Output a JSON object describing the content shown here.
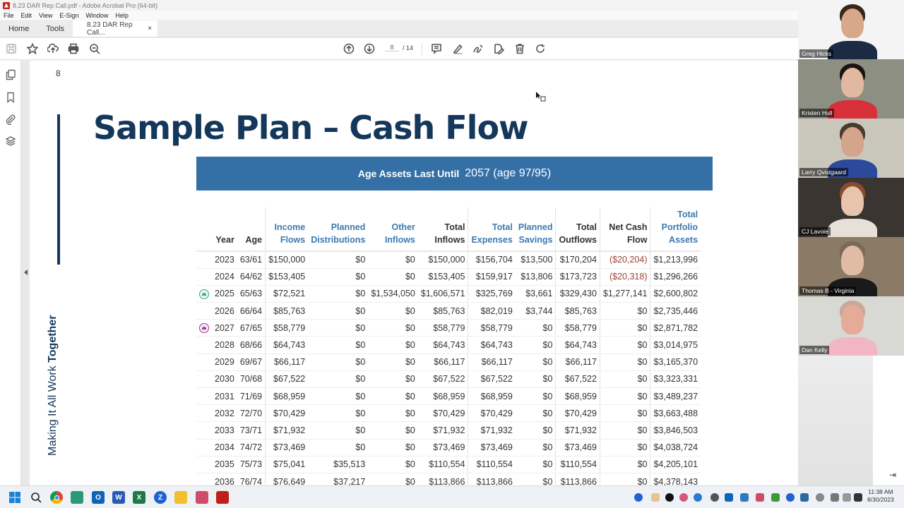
{
  "window": {
    "title": "8.23 DAR Rep Call.pdf - Adobe Acrobat Pro (64-bit)"
  },
  "menu": [
    "File",
    "Edit",
    "View",
    "E-Sign",
    "Window",
    "Help"
  ],
  "tabs": {
    "home": "Home",
    "tools": "Tools",
    "document": "8.23 DAR Rep Call...",
    "close": "×"
  },
  "toolbar": {
    "current_page": "8",
    "total_pages": "/ 14",
    "icons": [
      "save-icon",
      "star-icon",
      "upload-icon",
      "print-icon",
      "zoom-out-icon",
      "page-up-icon",
      "page-down-icon",
      "comment-icon",
      "highlight-icon",
      "sign-icon",
      "edit-pdf-icon",
      "delete-icon",
      "rotate-icon"
    ]
  },
  "left_rail": [
    "pages-icon",
    "bookmark-icon",
    "attachment-icon",
    "layers-icon"
  ],
  "slide": {
    "page_number": "8",
    "title": "Sample Plan – Cash Flow",
    "side_text_regular": "Making It All Work ",
    "side_text_bold": "Together",
    "banner_label": "Age Assets Last Until",
    "banner_value": "2057 (age 97/95)"
  },
  "table": {
    "headers": [
      {
        "line1": "",
        "line2": "",
        "line3": "Year",
        "blue": false
      },
      {
        "line1": "",
        "line2": "",
        "line3": "Age",
        "blue": false
      },
      {
        "line1": "",
        "line2": "Income",
        "line3": "Flows",
        "blue": true
      },
      {
        "line1": "",
        "line2": "Planned",
        "line3": "Distributions",
        "blue": true
      },
      {
        "line1": "",
        "line2": "Other",
        "line3": "Inflows",
        "blue": true
      },
      {
        "line1": "",
        "line2": "Total",
        "line3": "Inflows",
        "blue": false
      },
      {
        "line1": "",
        "line2": "Total",
        "line3": "Expenses",
        "blue": true
      },
      {
        "line1": "",
        "line2": "Planned",
        "line3": "Savings",
        "blue": true
      },
      {
        "line1": "",
        "line2": "Total",
        "line3": "Outflows",
        "blue": false
      },
      {
        "line1": "",
        "line2": "Net Cash",
        "line3": "Flow",
        "blue": false
      },
      {
        "line1": "Total",
        "line2": "Portfolio",
        "line3": "Assets",
        "blue": true
      }
    ],
    "rows": [
      {
        "marker": "",
        "cells": [
          "2023",
          "63/61",
          "$150,000",
          "$0",
          "$0",
          "$150,000",
          "$156,704",
          "$13,500",
          "$170,204",
          "($20,204)",
          "$1,213,996"
        ],
        "negative": true
      },
      {
        "marker": "",
        "cells": [
          "2024",
          "64/62",
          "$153,405",
          "$0",
          "$0",
          "$153,405",
          "$159,917",
          "$13,806",
          "$173,723",
          "($20,318)",
          "$1,296,266"
        ],
        "negative": true
      },
      {
        "marker": "green",
        "cells": [
          "2025",
          "65/63",
          "$72,521",
          "$0",
          "$1,534,050",
          "$1,606,571",
          "$325,769",
          "$3,661",
          "$329,430",
          "$1,277,141",
          "$2,600,802"
        ],
        "negative": false
      },
      {
        "marker": "",
        "cells": [
          "2026",
          "66/64",
          "$85,763",
          "$0",
          "$0",
          "$85,763",
          "$82,019",
          "$3,744",
          "$85,763",
          "$0",
          "$2,735,446"
        ],
        "negative": false
      },
      {
        "marker": "purple",
        "cells": [
          "2027",
          "67/65",
          "$58,779",
          "$0",
          "$0",
          "$58,779",
          "$58,779",
          "$0",
          "$58,779",
          "$0",
          "$2,871,782"
        ],
        "negative": false
      },
      {
        "marker": "",
        "cells": [
          "2028",
          "68/66",
          "$64,743",
          "$0",
          "$0",
          "$64,743",
          "$64,743",
          "$0",
          "$64,743",
          "$0",
          "$3,014,975"
        ],
        "negative": false
      },
      {
        "marker": "",
        "cells": [
          "2029",
          "69/67",
          "$66,117",
          "$0",
          "$0",
          "$66,117",
          "$66,117",
          "$0",
          "$66,117",
          "$0",
          "$3,165,370"
        ],
        "negative": false
      },
      {
        "marker": "",
        "cells": [
          "2030",
          "70/68",
          "$67,522",
          "$0",
          "$0",
          "$67,522",
          "$67,522",
          "$0",
          "$67,522",
          "$0",
          "$3,323,331"
        ],
        "negative": false
      },
      {
        "marker": "",
        "cells": [
          "2031",
          "71/69",
          "$68,959",
          "$0",
          "$0",
          "$68,959",
          "$68,959",
          "$0",
          "$68,959",
          "$0",
          "$3,489,237"
        ],
        "negative": false
      },
      {
        "marker": "",
        "cells": [
          "2032",
          "72/70",
          "$70,429",
          "$0",
          "$0",
          "$70,429",
          "$70,429",
          "$0",
          "$70,429",
          "$0",
          "$3,663,488"
        ],
        "negative": false
      },
      {
        "marker": "",
        "cells": [
          "2033",
          "73/71",
          "$71,932",
          "$0",
          "$0",
          "$71,932",
          "$71,932",
          "$0",
          "$71,932",
          "$0",
          "$3,846,503"
        ],
        "negative": false
      },
      {
        "marker": "",
        "cells": [
          "2034",
          "74/72",
          "$73,469",
          "$0",
          "$0",
          "$73,469",
          "$73,469",
          "$0",
          "$73,469",
          "$0",
          "$4,038,724"
        ],
        "negative": false
      },
      {
        "marker": "",
        "cells": [
          "2035",
          "75/73",
          "$75,041",
          "$35,513",
          "$0",
          "$110,554",
          "$110,554",
          "$0",
          "$110,554",
          "$0",
          "$4,205,101"
        ],
        "negative": false
      },
      {
        "marker": "",
        "cells": [
          "2036",
          "76/74",
          "$76,649",
          "$37,217",
          "$0",
          "$113,866",
          "$113,866",
          "$0",
          "$113,866",
          "$0",
          "$4,378,143"
        ],
        "negative": false
      }
    ]
  },
  "participants": [
    {
      "name": "Greg Hicks",
      "bg": "#f4f4f4",
      "skin": "#d9a88a",
      "shirt": "#1d2a44",
      "hair": "#3a2518"
    },
    {
      "name": "Kristen Hull",
      "bg": "#8c8f82",
      "skin": "#e1b9a0",
      "shirt": "#d8303a",
      "hair": "#1c1412"
    },
    {
      "name": "Larry Qvistgaard",
      "bg": "#c9c6bc",
      "skin": "#d4a48c",
      "shirt": "#2c4a9b",
      "hair": "#4a3a2a"
    },
    {
      "name": "CJ Lavoie",
      "bg": "#3a3530",
      "skin": "#e6c4ae",
      "shirt": "#e8e0d8",
      "hair": "#8a4a30"
    },
    {
      "name": "Thomas B - Virginia",
      "bg": "#8a7a66",
      "skin": "#e0bca5",
      "shirt": "#1a1a1a",
      "hair": "#7a6a5a"
    },
    {
      "name": "Dan Kelly",
      "bg": "#d8d8d4",
      "skin": "#e4ac98",
      "shirt": "#f2b5c4",
      "hair": "#c8a898"
    }
  ],
  "taskbar": {
    "apps": [
      {
        "name": "windows-start-icon",
        "label": "",
        "color": "#1a83d6"
      },
      {
        "name": "search-icon",
        "label": "",
        "color": "transparent"
      },
      {
        "name": "chrome-icon",
        "label": "",
        "color": "#e2a02a"
      },
      {
        "name": "edge-icon",
        "label": "",
        "color": "#2a9a74"
      },
      {
        "name": "outlook-icon",
        "label": "O",
        "color": "#0f63b8"
      },
      {
        "name": "word-icon",
        "label": "W",
        "color": "#2a5ab8"
      },
      {
        "name": "excel-icon",
        "label": "X",
        "color": "#1d7a45"
      },
      {
        "name": "zoom-app-icon",
        "label": "Z",
        "color": "#1f62d0"
      },
      {
        "name": "file-explorer-icon",
        "label": "",
        "color": "#f0c030"
      },
      {
        "name": "slack-icon",
        "label": "",
        "color": "#d04a6a"
      },
      {
        "name": "acrobat-icon",
        "label": "",
        "color": "#c02018"
      }
    ],
    "time": "11:38 AM",
    "date": "8/30/2023"
  }
}
